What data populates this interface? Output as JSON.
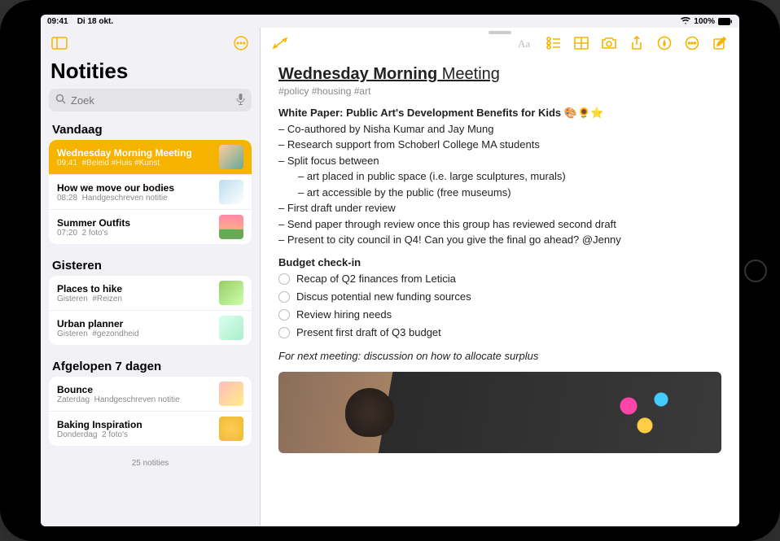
{
  "status": {
    "time": "09:41",
    "date": "Di 18 okt.",
    "battery": "100%"
  },
  "sidebar": {
    "title": "Notities",
    "search_placeholder": "Zoek",
    "footer": "25 notities",
    "sections": [
      {
        "header": "Vandaag",
        "items": [
          {
            "title": "Wednesday Morning Meeting",
            "time": "09:41",
            "sub": "#Beleid #Huis #Kunst",
            "selected": true
          },
          {
            "title": "How we move our bodies",
            "time": "08:28",
            "sub": "Handgeschreven notitie"
          },
          {
            "title": "Summer Outfits",
            "time": "07:20",
            "sub": "2 foto's"
          }
        ]
      },
      {
        "header": "Gisteren",
        "items": [
          {
            "title": "Places to hike",
            "time": "Gisteren",
            "sub": "#Reizen"
          },
          {
            "title": "Urban planner",
            "time": "Gisteren",
            "sub": "#gezondheid"
          }
        ]
      },
      {
        "header": "Afgelopen 7 dagen",
        "items": [
          {
            "title": "Bounce",
            "time": "Zaterdag",
            "sub": "Handgeschreven notitie"
          },
          {
            "title": "Baking Inspiration",
            "time": "Donderdag",
            "sub": "2 foto's"
          }
        ]
      }
    ]
  },
  "note": {
    "title_bold": "Wednesday Morning",
    "title_rest": " Meeting",
    "tags": "#policy #housing #art",
    "paper_heading": "White Paper: Public Art's Development Benefits for Kids 🎨🌻⭐",
    "bullets": [
      "– Co-authored by Nisha Kumar and Jay Mung",
      "– Research support from Schoberl College MA students",
      "– Split focus between"
    ],
    "sub_bullets": [
      "– art placed in public space (i.e. large sculptures, murals)",
      "– art accessible by the public (free museums)"
    ],
    "bullets2": [
      "– First draft under review",
      "– Send paper through review once this group has reviewed second draft",
      "– Present to city council in Q4! Can you give the final go ahead? @Jenny"
    ],
    "checklist_title": "Budget check-in",
    "checklist": [
      "Recap of Q2 finances from Leticia",
      "Discus potential new funding sources",
      "Review hiring needs",
      "Present first draft of Q3 budget"
    ],
    "footer_italic": "For next meeting: discussion on how to allocate surplus"
  }
}
